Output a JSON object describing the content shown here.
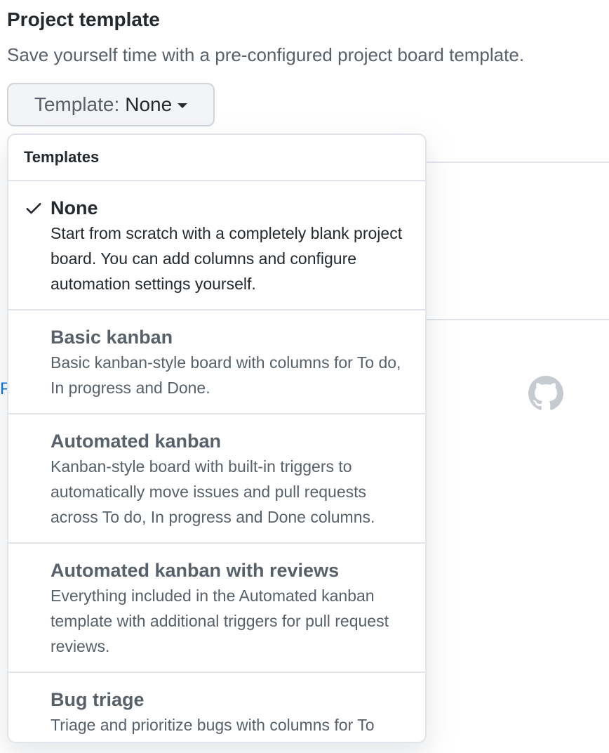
{
  "section": {
    "title": "Project template",
    "description": "Save yourself time with a pre-configured project board template."
  },
  "template_button": {
    "prefix": "Template:",
    "value": "None",
    "icon": "triangle-down-icon"
  },
  "dropdown": {
    "header": "Templates",
    "options": [
      {
        "title": "None",
        "description": "Start from scratch with a completely blank project board. You can add columns and configure automation settings yourself.",
        "selected": true
      },
      {
        "title": "Basic kanban",
        "description": "Basic kanban-style board with columns for To do, In progress and Done.",
        "selected": false
      },
      {
        "title": "Automated kanban",
        "description": "Kanban-style board with built-in triggers to automatically move issues and pull requests across To do, In progress and Done columns.",
        "selected": false
      },
      {
        "title": "Automated kanban with reviews",
        "description": "Everything included in the Automated kanban template with additional triggers for pull request reviews.",
        "selected": false
      },
      {
        "title": "Bug triage",
        "description": "Triage and prioritize bugs with columns for To",
        "selected": false
      }
    ]
  },
  "background": {
    "link_fragment": "P",
    "logo_icon": "github-logo-icon"
  },
  "colors": {
    "text_primary": "#24292e",
    "text_secondary": "#586069",
    "border": "#e1e4e8",
    "link": "#0366d6",
    "logo": "#c6cbd1"
  }
}
